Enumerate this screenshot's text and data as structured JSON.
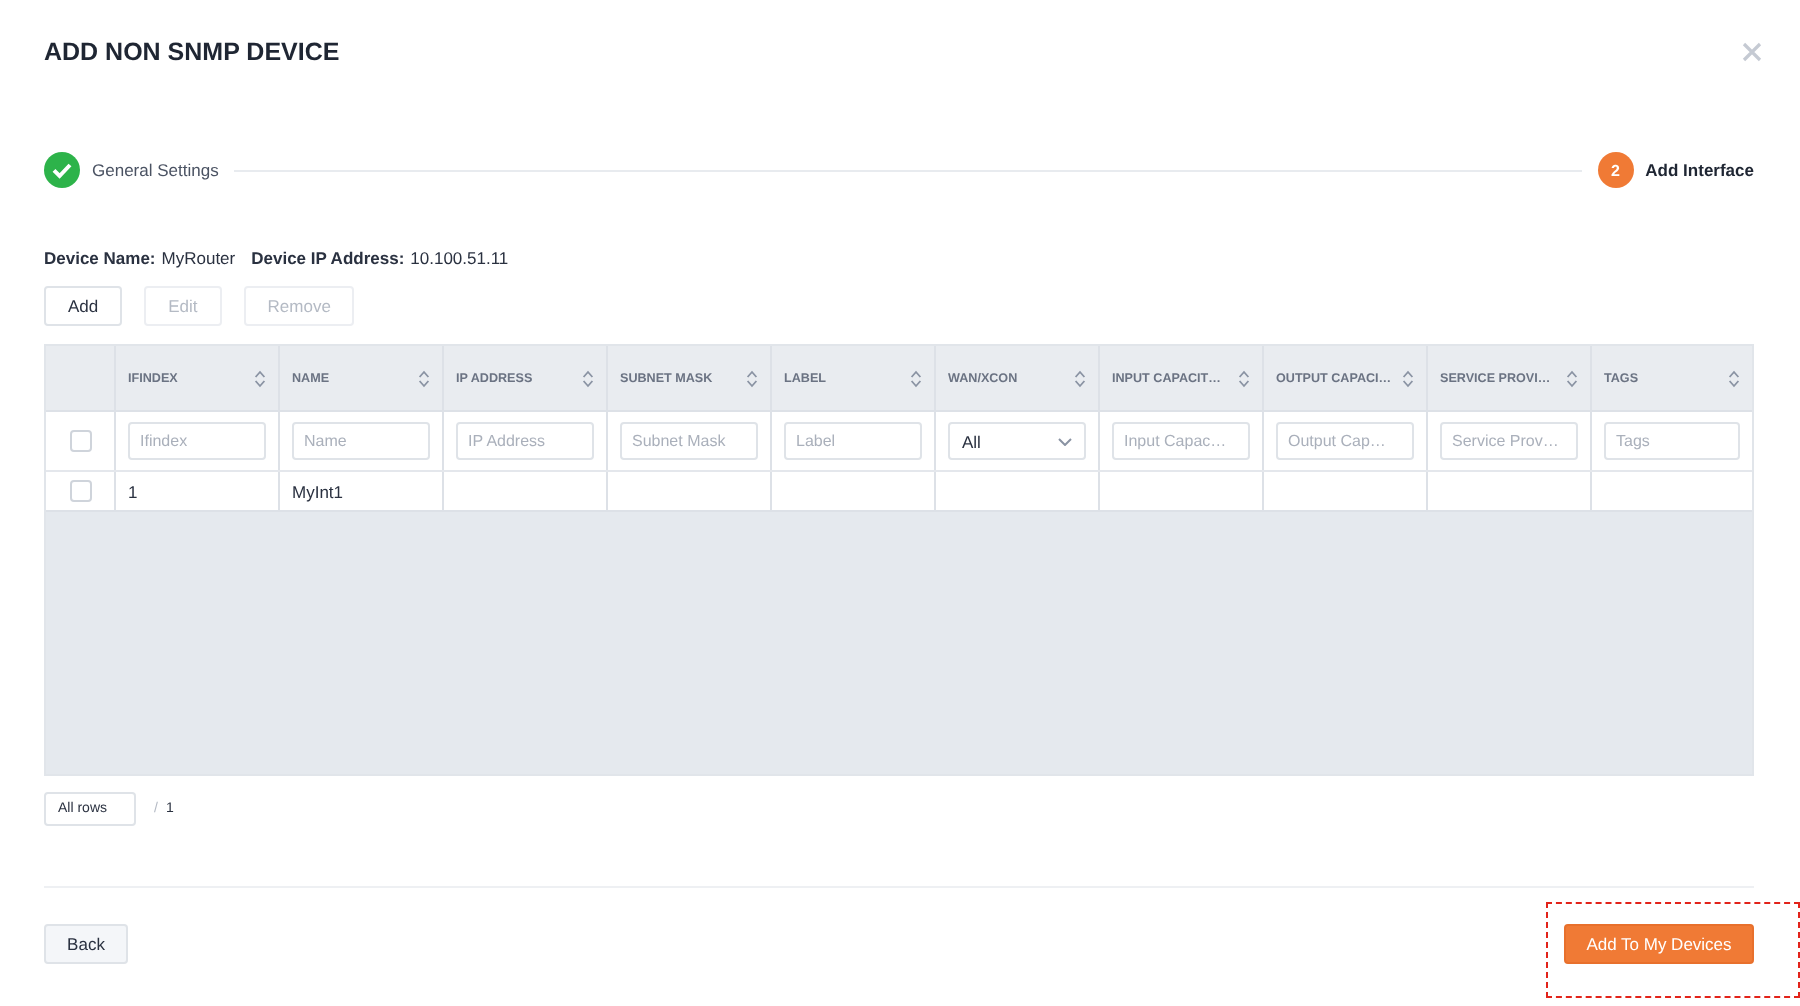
{
  "dialog": {
    "title": "ADD NON SNMP DEVICE"
  },
  "steps": [
    {
      "label": "General Settings",
      "completed": true,
      "active": false
    },
    {
      "label": "Add Interface",
      "number": "2",
      "completed": false,
      "active": true
    }
  ],
  "device": {
    "name_label": "Device Name:",
    "name": "MyRouter",
    "ip_label": "Device IP Address:",
    "ip": "10.100.51.11"
  },
  "toolbar": [
    {
      "label": "Add",
      "disabled": false
    },
    {
      "label": "Edit",
      "disabled": true
    },
    {
      "label": "Remove",
      "disabled": true
    }
  ],
  "table": {
    "columns": [
      {
        "label": "IFINDEX",
        "filter": {
          "kind": "text",
          "placeholder": "Ifindex"
        }
      },
      {
        "label": "NAME",
        "filter": {
          "kind": "text",
          "placeholder": "Name"
        }
      },
      {
        "label": "IP ADDRESS",
        "filter": {
          "kind": "text",
          "placeholder": "IP Address"
        }
      },
      {
        "label": "SUBNET MASK",
        "filter": {
          "kind": "text",
          "placeholder": "Subnet Mask"
        }
      },
      {
        "label": "LABEL",
        "filter": {
          "kind": "text",
          "placeholder": "Label"
        }
      },
      {
        "label": "WAN/XCON",
        "filter": {
          "kind": "select",
          "value": "All"
        }
      },
      {
        "label": "INPUT CAPACIT…",
        "filter": {
          "kind": "text",
          "placeholder": "Input Capac…"
        }
      },
      {
        "label": "OUTPUT CAPACI…",
        "filter": {
          "kind": "text",
          "placeholder": "Output Cap…"
        }
      },
      {
        "label": "SERVICE PROVI…",
        "filter": {
          "kind": "text",
          "placeholder": "Service Prov…"
        }
      },
      {
        "label": "TAGS",
        "filter": {
          "kind": "text",
          "placeholder": "Tags"
        }
      }
    ],
    "filter_row_checked": false,
    "rows": [
      {
        "checked": false,
        "cells": [
          "1",
          "MyInt1",
          "",
          "",
          "",
          "",
          "",
          "",
          "",
          ""
        ]
      }
    ]
  },
  "pagination": {
    "rows_option": "All rows",
    "separator": "/",
    "count": "1"
  },
  "footer": {
    "back": "Back",
    "primary": {
      "label": "Add To My Devices",
      "highlighted": true
    }
  }
}
